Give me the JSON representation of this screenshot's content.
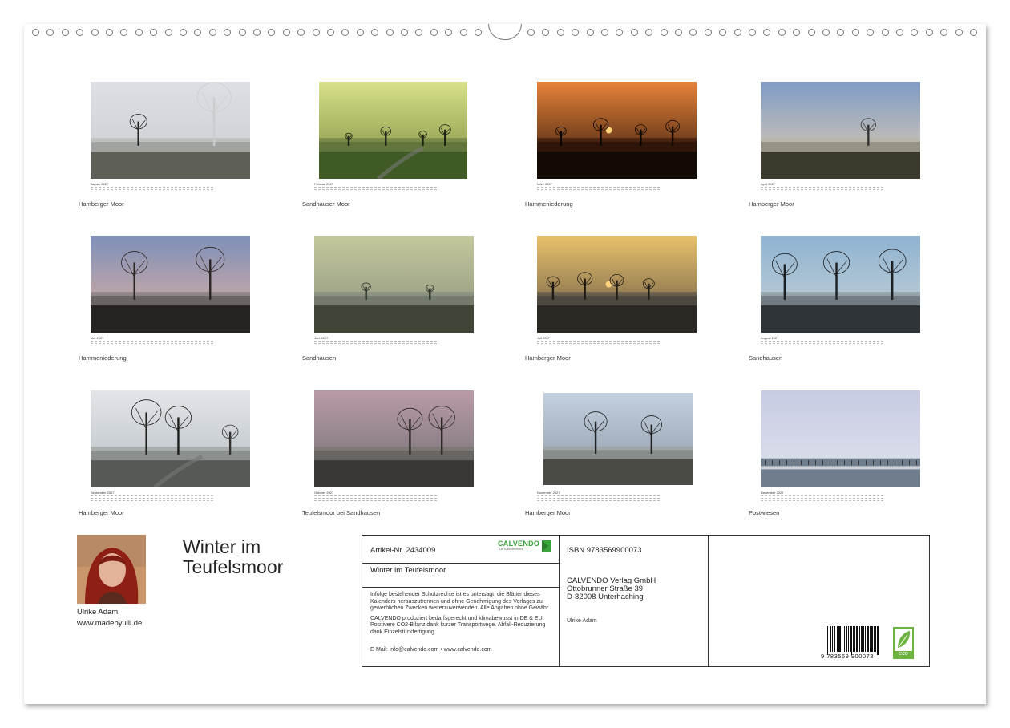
{
  "months": [
    {
      "label": "Januar 2027",
      "caption": "Hamberger Moor"
    },
    {
      "label": "Februar 2027",
      "caption": "Sandhauser Moor"
    },
    {
      "label": "März 2027",
      "caption": "Hammeniederung"
    },
    {
      "label": "April 2027",
      "caption": "Hamberger Moor"
    },
    {
      "label": "Mai 2027",
      "caption": "Hammeniederung"
    },
    {
      "label": "Juni 2027",
      "caption": "Sandhausen"
    },
    {
      "label": "Juli 2027",
      "caption": "Hamberger Moor"
    },
    {
      "label": "August 2027",
      "caption": "Sandhausen"
    },
    {
      "label": "September 2027",
      "caption": "Hamberger Moor"
    },
    {
      "label": "Oktober 2027",
      "caption": "Teufelsmoor bei Sandhausen"
    },
    {
      "label": "November 2027",
      "caption": "Hamberger Moor"
    },
    {
      "label": "Dezember 2027",
      "caption": "Postwiesen"
    }
  ],
  "author": {
    "name": "Ulrike Adam",
    "website": "www.madebyulli.de"
  },
  "title": "Winter im Teufelsmoor",
  "info": {
    "article": "Artikel-Nr. 2434009",
    "brand": "CALVENDO",
    "brand_tagline": "Die Kalendermarke",
    "title_repeat": "Winter im Teufelsmoor",
    "legal1": "Infolge bestehender Schutzrechte ist es untersagt, die Blätter dieses Kalenders herauszutrennen und ohne Genehmigung des Verlages zu gewerblichen Zwecken weiterzuverwenden. Alle Angaben ohne Gewähr.",
    "legal2": "CALVENDO produziert bedarfsgerecht und klimabewusst in DE & EU. Positivere CO2-Bilanz dank kurzer Transportwege. Abfall-Reduzierung dank Einzelstückfertigung.",
    "contact": "E-Mail: info@calvendo.com • www.calvendo.com",
    "isbn": "ISBN 9783569900073",
    "publisher_line1": "CALVENDO Verlag GmbH",
    "publisher_line2": "Ottobrunner Straße 39",
    "publisher_line3": "D-82008 Unterhaching",
    "author": "Ulrike Adam",
    "barcode_number": "9 783569 900073",
    "eco_label": "eco"
  },
  "colors": {
    "calvendo_green": "#3aa33a",
    "eco_green": "#6cb33f"
  }
}
